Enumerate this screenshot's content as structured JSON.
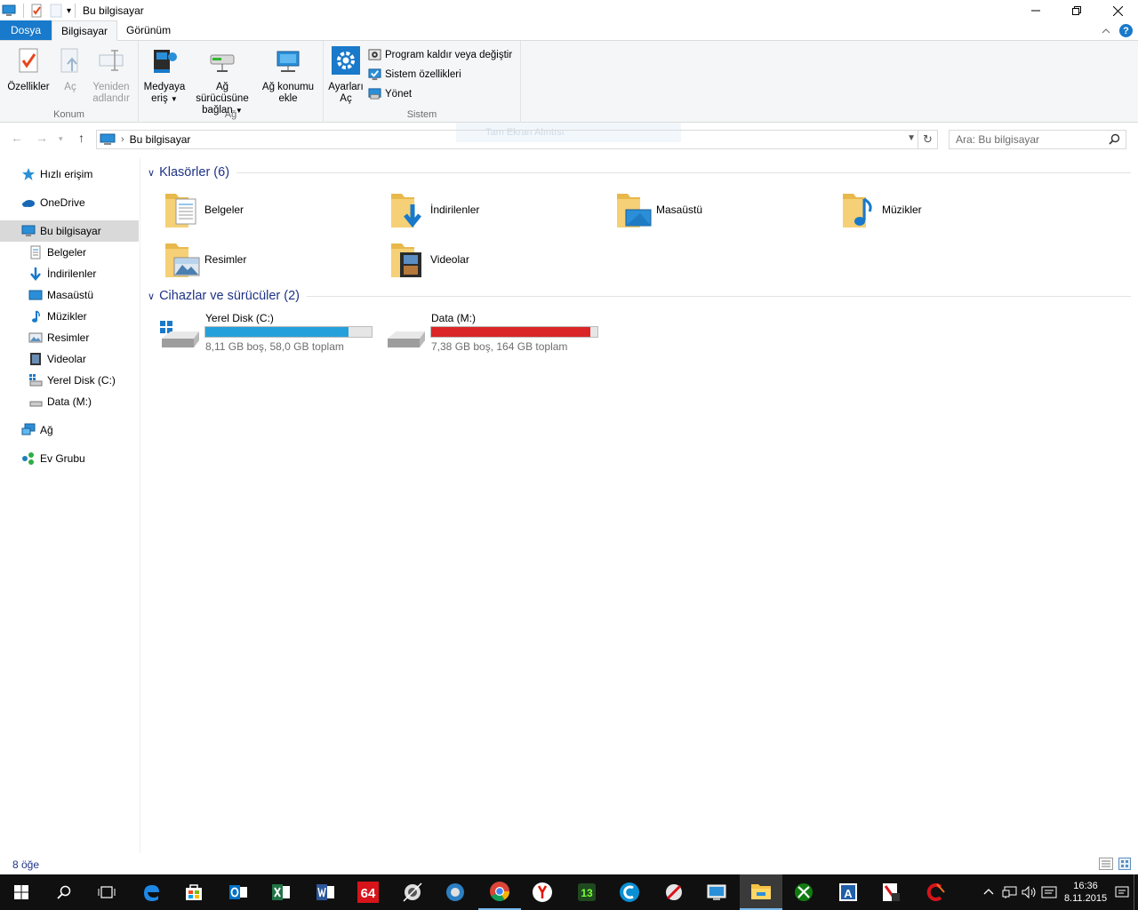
{
  "window": {
    "title": "Bu bilgisayar",
    "minimize_icon": "minimize-icon",
    "maximize_icon": "restore-icon",
    "close_icon": "close-icon"
  },
  "ribbon_tabs": [
    {
      "label": "Dosya"
    },
    {
      "label": "Bilgisayar"
    },
    {
      "label": "Görünüm"
    }
  ],
  "ribbon": {
    "konum": {
      "label": "Konum",
      "buttons": [
        {
          "label1": "Özellikler",
          "label2": ""
        },
        {
          "label1": "Aç",
          "label2": ""
        },
        {
          "label1": "Yeniden",
          "label2": "adlandır"
        }
      ]
    },
    "ag": {
      "label": "Ağ",
      "buttons": [
        {
          "label1": "Medyaya",
          "label2": "eriş"
        },
        {
          "label1": "Ağ sürücüsüne",
          "label2": "bağlan"
        },
        {
          "label1": "Ağ konumu",
          "label2": "ekle"
        }
      ]
    },
    "sistem": {
      "label": "Sistem",
      "big": {
        "label1": "Ayarları",
        "label2": "Aç"
      },
      "small": [
        {
          "label": "Program kaldır veya değiştir"
        },
        {
          "label": "Sistem özellikleri"
        },
        {
          "label": "Yönet"
        }
      ]
    }
  },
  "address": {
    "crumb": "Bu bilgisayar",
    "search_placeholder": "Ara: Bu bilgisayar",
    "ghost_text": "Tam Ekran Alıntısı"
  },
  "navpane": [
    {
      "label": "Hızlı erişim",
      "icon": "star-icon"
    },
    {
      "label": "OneDrive",
      "icon": "cloud-icon"
    },
    {
      "label": "Bu bilgisayar",
      "icon": "computer-icon"
    },
    {
      "label": "Belgeler",
      "icon": "document-icon"
    },
    {
      "label": "İndirilenler",
      "icon": "download-icon"
    },
    {
      "label": "Masaüstü",
      "icon": "desktop-icon"
    },
    {
      "label": "Müzikler",
      "icon": "music-icon"
    },
    {
      "label": "Resimler",
      "icon": "picture-icon"
    },
    {
      "label": "Videolar",
      "icon": "video-icon"
    },
    {
      "label": "Yerel Disk (C:)",
      "icon": "system-drive-icon"
    },
    {
      "label": "Data (M:)",
      "icon": "drive-icon"
    },
    {
      "label": "Ağ",
      "icon": "network-icon"
    },
    {
      "label": "Ev Grubu",
      "icon": "homegroup-icon"
    }
  ],
  "content": {
    "folders_header": "Klasörler (6)",
    "folders": [
      {
        "label": "Belgeler"
      },
      {
        "label": "İndirilenler"
      },
      {
        "label": "Masaüstü"
      },
      {
        "label": "Müzikler"
      },
      {
        "label": "Resimler"
      },
      {
        "label": "Videolar"
      }
    ],
    "drives_header": "Cihazlar ve sürücüler (2)",
    "drives": [
      {
        "label": "Yerel Disk (C:)",
        "stats": "8,11 GB boş, 58,0 GB toplam",
        "used_fraction": 0.86,
        "bar_color": "#26a0da"
      },
      {
        "label": "Data (M:)",
        "stats": "7,38 GB boş, 164 GB toplam",
        "used_fraction": 0.955,
        "bar_color": "#da2626"
      }
    ]
  },
  "status": {
    "item_count": "8 öğe"
  },
  "taskbar": {
    "apps": [
      "start-icon",
      "search-icon",
      "task-view-icon",
      "edge-icon",
      "store-icon",
      "outlook-icon",
      "excel-icon",
      "word-icon",
      "aida64-icon",
      "app-icon",
      "app-icon",
      "chrome-icon",
      "yandex-icon",
      "app-icon",
      "ccleaner-browser-icon",
      "app-icon",
      "app-icon",
      "file-explorer-icon",
      "xbox-icon",
      "app-icon",
      "app-icon",
      "ccleaner-icon"
    ],
    "time": "16:36",
    "date": "8.11.2015"
  },
  "colors": {
    "accent": "#1979ca",
    "heading": "#1e3287",
    "selection": "#d9d9d9"
  }
}
